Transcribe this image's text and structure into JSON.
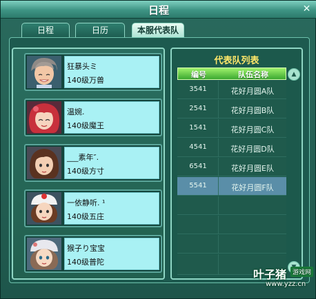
{
  "window": {
    "title": "日程"
  },
  "tabs": [
    {
      "label": "日程"
    },
    {
      "label": "日历"
    },
    {
      "label": "本服代表队"
    }
  ],
  "members": [
    {
      "name": "狂暴头ミ",
      "level": "140级万兽"
    },
    {
      "name": "温婉.",
      "level": "140级魔王"
    },
    {
      "name": "___素年″.",
      "level": "140级方寸"
    },
    {
      "name": "一依静听. ¹",
      "level": "140级五庄"
    },
    {
      "name": "猴子り宝宝",
      "level": "140级普陀"
    }
  ],
  "team_list": {
    "title": "代表队列表",
    "col_num": "编号",
    "col_team": "队伍名称",
    "rows": [
      {
        "num": "3541",
        "team": "花好月圆A队"
      },
      {
        "num": "2541",
        "team": "花好月圆B队"
      },
      {
        "num": "1541",
        "team": "花好月圆C队"
      },
      {
        "num": "4541",
        "team": "花好月圆D队"
      },
      {
        "num": "6541",
        "team": "花好月圆E队"
      },
      {
        "num": "5541",
        "team": "花好月圆F队"
      }
    ],
    "selected_index": 5
  },
  "watermark": {
    "brand": "叶子猪",
    "badge": "游戏网",
    "url": "www.yzz.cn"
  },
  "colors": {
    "accent_title": "#ffe86a",
    "header_green": "#3aa830",
    "selected_row": "#5a8ea8",
    "info_bg": "#a9f1f4"
  }
}
